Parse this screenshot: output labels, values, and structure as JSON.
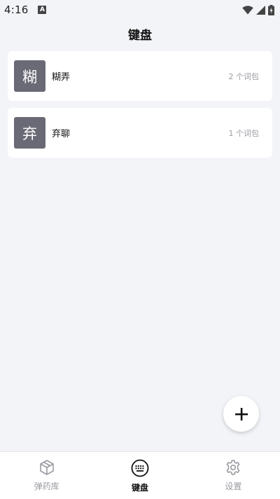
{
  "status_bar": {
    "time": "4:16",
    "notification_letter": "A"
  },
  "header": {
    "title": "键盘"
  },
  "keyboards": [
    {
      "icon_char": "糊",
      "name": "糊弄",
      "count": "2 个词包"
    },
    {
      "icon_char": "弃",
      "name": "弃聊",
      "count": "1 个词包"
    }
  ],
  "fab": {
    "icon": "plus-icon"
  },
  "bottom_nav": [
    {
      "label": "弹药库",
      "icon": "cube-icon",
      "active": false
    },
    {
      "label": "键盘",
      "icon": "keyboard-icon",
      "active": true
    },
    {
      "label": "设置",
      "icon": "gear-icon",
      "active": false
    }
  ],
  "colors": {
    "background": "#f3f4f8",
    "card": "#ffffff",
    "avatar": "#6a6a76",
    "muted": "#9a9aa2"
  }
}
